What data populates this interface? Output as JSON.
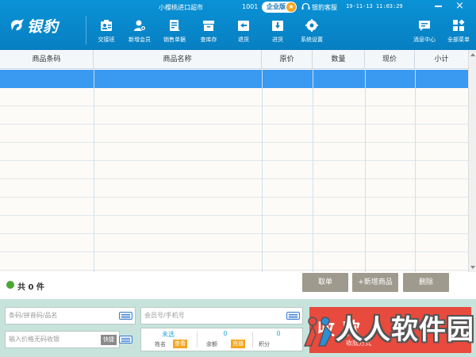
{
  "app": {
    "logo_text": "银豹",
    "store_name": "小樱桃进口超市",
    "store_id": "1001",
    "edition": "企业版",
    "edition_star": "★",
    "customer_service": "银豹客服",
    "datetime": "19-11-13 11:03:29",
    "close_symbol": "×"
  },
  "toolbar": {
    "items": [
      {
        "label": "交接班",
        "icon": "shift-handover-icon"
      },
      {
        "label": "新增会员",
        "icon": "add-member-icon"
      },
      {
        "label": "销售单据",
        "icon": "sales-receipt-icon"
      },
      {
        "label": "查库存",
        "icon": "inventory-icon"
      },
      {
        "label": "退货",
        "icon": "return-icon"
      },
      {
        "label": "进货",
        "icon": "purchase-icon"
      },
      {
        "label": "系统设置",
        "icon": "gear-icon"
      }
    ],
    "right_items": [
      {
        "label": "消息中心",
        "icon": "message-icon"
      },
      {
        "label": "全部菜单",
        "icon": "all-menu-icon"
      }
    ]
  },
  "grid": {
    "columns": [
      "商品条码",
      "商品名称",
      "原价",
      "数量",
      "现价",
      "小计"
    ],
    "rows": []
  },
  "summary": {
    "count_label": "共 0 件"
  },
  "actions": {
    "hold": "取单",
    "add_product": "+新增商品",
    "delete": "删除"
  },
  "inputs": {
    "barcode_placeholder": "条码/拼音码/品名",
    "price_placeholder": "输入价格无码收银",
    "quick_label": "快捷",
    "member_placeholder": "会员号/手机号"
  },
  "member": {
    "name_value": "未选",
    "name_label": "姓名",
    "name_action": "查看",
    "balance_value": "0",
    "balance_label": "余额",
    "balance_action": "充值",
    "points_value": "0",
    "points_label": "积分"
  },
  "checkout": {
    "label": "收款",
    "sub": "收款方式"
  },
  "watermark": {
    "text": "人人软件园"
  }
}
